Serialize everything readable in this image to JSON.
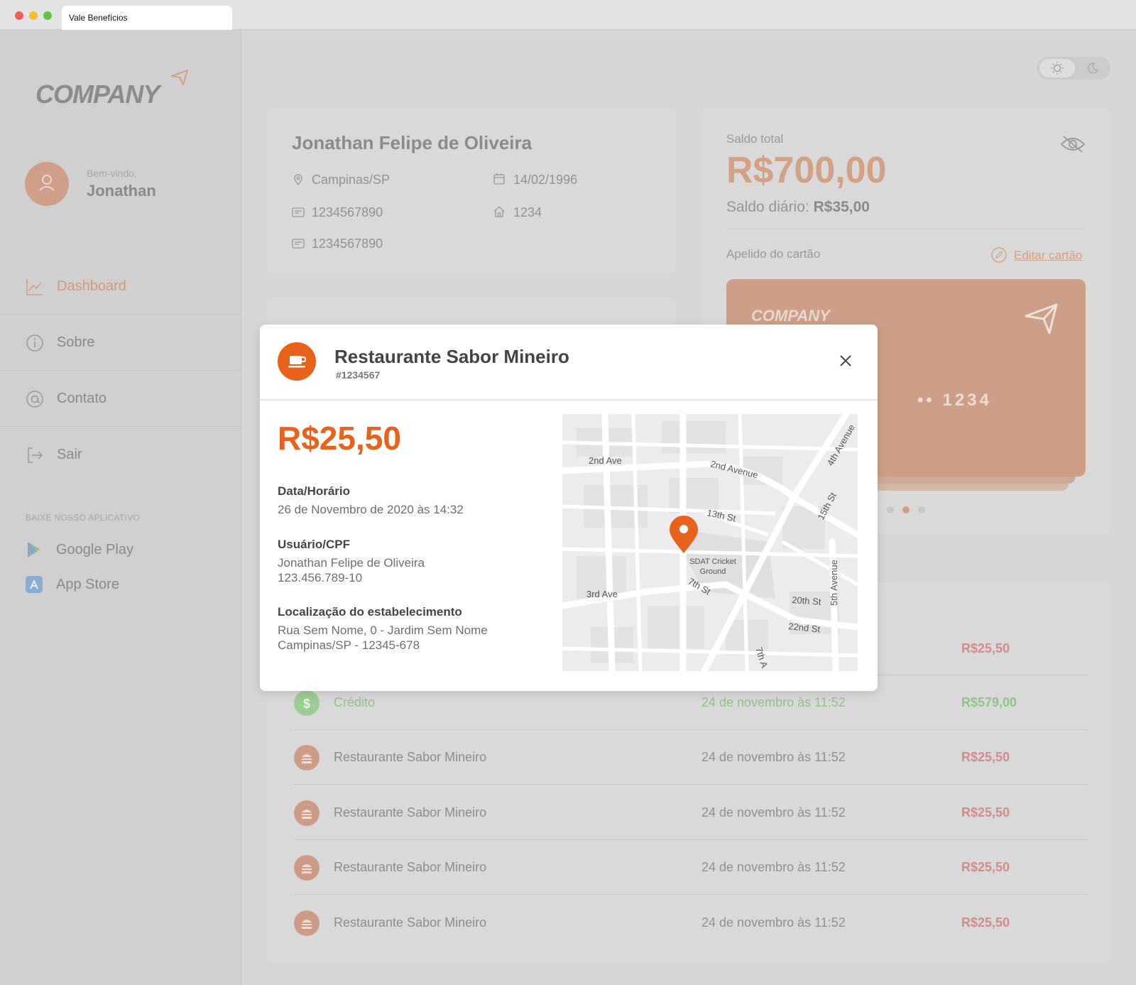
{
  "browser": {
    "tab_title": "Vale Benefícios"
  },
  "sidebar": {
    "logo": "COMPANY",
    "welcome": "Bem-vindo,",
    "user_name": "Jonathan",
    "nav": [
      {
        "label": "Dashboard",
        "icon": "chart-line-icon",
        "active": true
      },
      {
        "label": "Sobre",
        "icon": "info-icon"
      },
      {
        "label": "Contato",
        "icon": "at-icon"
      },
      {
        "label": "Sair",
        "icon": "logout-icon"
      }
    ],
    "store_title": "BAIXE NOSSO APLICATIVO",
    "stores": [
      {
        "label": "Google Play",
        "icon": "google-play-icon"
      },
      {
        "label": "App Store",
        "icon": "app-store-icon"
      }
    ]
  },
  "profile": {
    "name": "Jonathan Felipe de Oliveira",
    "city": "Campinas/SP",
    "birthdate": "14/02/1996",
    "doc1": "1234567890",
    "number": "1234",
    "doc2": "1234567890"
  },
  "balance": {
    "total_label": "Saldo total",
    "total_value": "R$700,00",
    "daily_label": "Saldo diário:",
    "daily_value": "R$35,00",
    "nickname_label": "Apelido do cartão",
    "edit_label": "Editar cartão",
    "card_logo": "COMPANY",
    "card_number": "•• 1234"
  },
  "transactions": [
    {
      "name": "Crédito",
      "date": "24 de novembro às 11:52",
      "amount": "R$579,00",
      "type": "credit"
    },
    {
      "name": "Restaurante Sabor Mineiro",
      "date": "24 de novembro às 11:52",
      "amount": "R$25,50",
      "type": "debit"
    },
    {
      "name": "Restaurante Sabor Mineiro",
      "date": "24 de novembro às 11:52",
      "amount": "R$25,50",
      "type": "debit"
    },
    {
      "name": "Restaurante Sabor Mineiro",
      "date": "24 de novembro às 11:52",
      "amount": "R$25,50",
      "type": "debit"
    },
    {
      "name": "Restaurante Sabor Mineiro",
      "date": "24 de novembro às 11:52",
      "amount": "R$25,50",
      "type": "debit"
    }
  ],
  "partial_amount": "R$25,50",
  "modal": {
    "title": "Restaurante Sabor Mineiro",
    "id": "#1234567",
    "amount": "R$25,50",
    "date_label": "Data/Horário",
    "date_value": "26 de Novembro de 2020 às 14:32",
    "user_label": "Usuário/CPF",
    "user_name": "Jonathan Felipe de Oliveira",
    "user_cpf": "123.456.789-10",
    "location_label": "Localização do estabelecimento",
    "address_line1": "Rua Sem Nome, 0 - Jardim Sem Nome",
    "address_line2": "Campinas/SP - 12345-678",
    "map": {
      "streets": [
        "2nd Ave",
        "2nd Avenue",
        "4th Avenue",
        "13th St",
        "15th St",
        "3rd Ave",
        "7th St",
        "5th Avenue",
        "20th St",
        "22nd St",
        "7th A"
      ],
      "place": "SDAT Cricket",
      "place2": "Ground"
    }
  },
  "colors": {
    "accent": "#e8621c",
    "muted_accent": "#d3a184",
    "credit": "#92c48a",
    "debit": "#d38c8c"
  }
}
